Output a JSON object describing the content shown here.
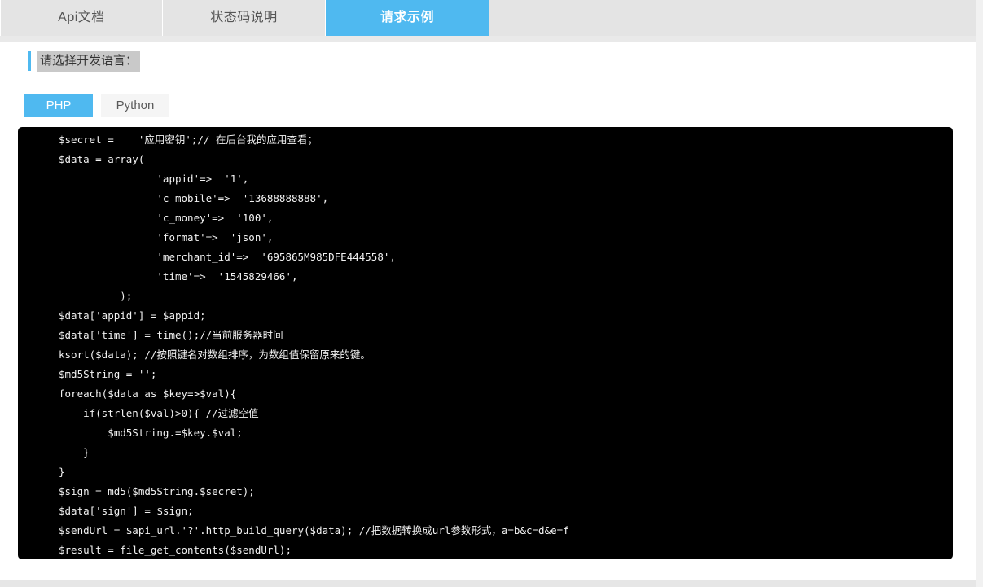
{
  "tabs": [
    {
      "label": "Api文档",
      "active": false
    },
    {
      "label": "状态码说明",
      "active": false
    },
    {
      "label": "请求示例",
      "active": true
    }
  ],
  "section": {
    "heading": "请选择开发语言："
  },
  "language_buttons": [
    {
      "label": "PHP",
      "active": true
    },
    {
      "label": "Python",
      "active": false
    }
  ],
  "code": {
    "language": "PHP",
    "lines": [
      "$secret =    '应用密钥';// 在后台我的应用查看；",
      "$data = array(",
      "                'appid'=>  '1',",
      "                'c_mobile'=>  '13688888888',",
      "                'c_money'=>  '100',",
      "                'format'=>  'json',",
      "                'merchant_id'=>  '695865M985DFE444558',",
      "                'time'=>  '1545829466',",
      "          );",
      "$data['appid'] = $appid;",
      "$data['time'] = time();//当前服务器时间",
      "ksort($data); //按照键名对数组排序，为数组值保留原来的键。",
      "$md5String = '';",
      "foreach($data as $key=>$val){",
      "    if(strlen($val)>0){ //过滤空值",
      "        $md5String.=$key.$val;",
      "    }",
      "}",
      "$sign = md5($md5String.$secret);",
      "$data['sign'] = $sign;",
      "$sendUrl = $api_url.'?'.http_build_query($data); //把数据转换成url参数形式，a=b&c=d&e=f",
      "$result = file_get_contents($sendUrl);"
    ]
  },
  "colors": {
    "accent": "#4FB9F0",
    "tabbar_bg": "#e4e4e4",
    "code_bg": "#000000",
    "code_fg": "#f2f2f2",
    "heading_highlight": "#c9c9c9"
  }
}
